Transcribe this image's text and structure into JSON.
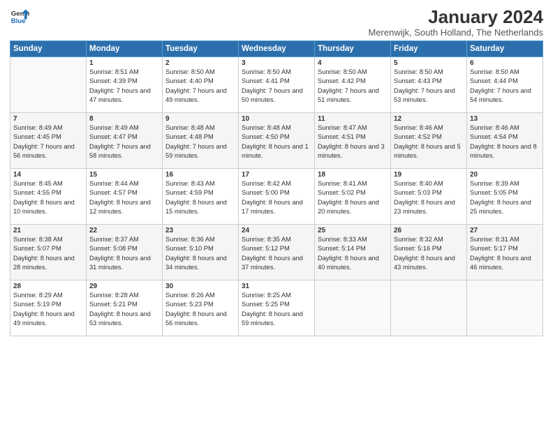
{
  "logo": {
    "line1": "General",
    "line2": "Blue"
  },
  "title": "January 2024",
  "subtitle": "Merenwijk, South Holland, The Netherlands",
  "days_of_week": [
    "Sunday",
    "Monday",
    "Tuesday",
    "Wednesday",
    "Thursday",
    "Friday",
    "Saturday"
  ],
  "weeks": [
    [
      {
        "day": "",
        "info": ""
      },
      {
        "day": "1",
        "info": "Sunrise: 8:51 AM\nSunset: 4:39 PM\nDaylight: 7 hours\nand 47 minutes."
      },
      {
        "day": "2",
        "info": "Sunrise: 8:50 AM\nSunset: 4:40 PM\nDaylight: 7 hours\nand 49 minutes."
      },
      {
        "day": "3",
        "info": "Sunrise: 8:50 AM\nSunset: 4:41 PM\nDaylight: 7 hours\nand 50 minutes."
      },
      {
        "day": "4",
        "info": "Sunrise: 8:50 AM\nSunset: 4:42 PM\nDaylight: 7 hours\nand 51 minutes."
      },
      {
        "day": "5",
        "info": "Sunrise: 8:50 AM\nSunset: 4:43 PM\nDaylight: 7 hours\nand 53 minutes."
      },
      {
        "day": "6",
        "info": "Sunrise: 8:50 AM\nSunset: 4:44 PM\nDaylight: 7 hours\nand 54 minutes."
      }
    ],
    [
      {
        "day": "7",
        "info": "Sunrise: 8:49 AM\nSunset: 4:45 PM\nDaylight: 7 hours\nand 56 minutes."
      },
      {
        "day": "8",
        "info": "Sunrise: 8:49 AM\nSunset: 4:47 PM\nDaylight: 7 hours\nand 58 minutes."
      },
      {
        "day": "9",
        "info": "Sunrise: 8:48 AM\nSunset: 4:48 PM\nDaylight: 7 hours\nand 59 minutes."
      },
      {
        "day": "10",
        "info": "Sunrise: 8:48 AM\nSunset: 4:50 PM\nDaylight: 8 hours\nand 1 minute."
      },
      {
        "day": "11",
        "info": "Sunrise: 8:47 AM\nSunset: 4:51 PM\nDaylight: 8 hours\nand 3 minutes."
      },
      {
        "day": "12",
        "info": "Sunrise: 8:46 AM\nSunset: 4:52 PM\nDaylight: 8 hours\nand 5 minutes."
      },
      {
        "day": "13",
        "info": "Sunrise: 8:46 AM\nSunset: 4:54 PM\nDaylight: 8 hours\nand 8 minutes."
      }
    ],
    [
      {
        "day": "14",
        "info": "Sunrise: 8:45 AM\nSunset: 4:55 PM\nDaylight: 8 hours\nand 10 minutes."
      },
      {
        "day": "15",
        "info": "Sunrise: 8:44 AM\nSunset: 4:57 PM\nDaylight: 8 hours\nand 12 minutes."
      },
      {
        "day": "16",
        "info": "Sunrise: 8:43 AM\nSunset: 4:59 PM\nDaylight: 8 hours\nand 15 minutes."
      },
      {
        "day": "17",
        "info": "Sunrise: 8:42 AM\nSunset: 5:00 PM\nDaylight: 8 hours\nand 17 minutes."
      },
      {
        "day": "18",
        "info": "Sunrise: 8:41 AM\nSunset: 5:02 PM\nDaylight: 8 hours\nand 20 minutes."
      },
      {
        "day": "19",
        "info": "Sunrise: 8:40 AM\nSunset: 5:03 PM\nDaylight: 8 hours\nand 23 minutes."
      },
      {
        "day": "20",
        "info": "Sunrise: 8:39 AM\nSunset: 5:05 PM\nDaylight: 8 hours\nand 25 minutes."
      }
    ],
    [
      {
        "day": "21",
        "info": "Sunrise: 8:38 AM\nSunset: 5:07 PM\nDaylight: 8 hours\nand 28 minutes."
      },
      {
        "day": "22",
        "info": "Sunrise: 8:37 AM\nSunset: 5:08 PM\nDaylight: 8 hours\nand 31 minutes."
      },
      {
        "day": "23",
        "info": "Sunrise: 8:36 AM\nSunset: 5:10 PM\nDaylight: 8 hours\nand 34 minutes."
      },
      {
        "day": "24",
        "info": "Sunrise: 8:35 AM\nSunset: 5:12 PM\nDaylight: 8 hours\nand 37 minutes."
      },
      {
        "day": "25",
        "info": "Sunrise: 8:33 AM\nSunset: 5:14 PM\nDaylight: 8 hours\nand 40 minutes."
      },
      {
        "day": "26",
        "info": "Sunrise: 8:32 AM\nSunset: 5:16 PM\nDaylight: 8 hours\nand 43 minutes."
      },
      {
        "day": "27",
        "info": "Sunrise: 8:31 AM\nSunset: 5:17 PM\nDaylight: 8 hours\nand 46 minutes."
      }
    ],
    [
      {
        "day": "28",
        "info": "Sunrise: 8:29 AM\nSunset: 5:19 PM\nDaylight: 8 hours\nand 49 minutes."
      },
      {
        "day": "29",
        "info": "Sunrise: 8:28 AM\nSunset: 5:21 PM\nDaylight: 8 hours\nand 53 minutes."
      },
      {
        "day": "30",
        "info": "Sunrise: 8:26 AM\nSunset: 5:23 PM\nDaylight: 8 hours\nand 56 minutes."
      },
      {
        "day": "31",
        "info": "Sunrise: 8:25 AM\nSunset: 5:25 PM\nDaylight: 8 hours\nand 59 minutes."
      },
      {
        "day": "",
        "info": ""
      },
      {
        "day": "",
        "info": ""
      },
      {
        "day": "",
        "info": ""
      }
    ]
  ]
}
